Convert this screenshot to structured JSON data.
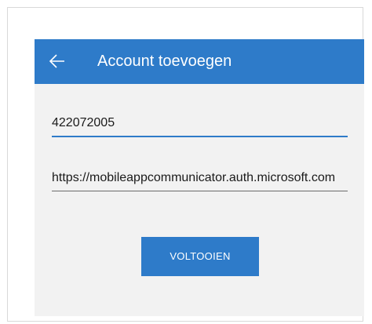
{
  "appbar": {
    "title": "Account toevoegen",
    "back_icon": "arrow-left-icon"
  },
  "form": {
    "account_name_value": "422072005",
    "url_value": "https://mobileappcommunicator.auth.microsoft.com",
    "finish_label": "VOLTOOIEN"
  },
  "colors": {
    "accent": "#2e7bc9",
    "background": "#f2f2f2",
    "text": "#1a1a1a"
  }
}
